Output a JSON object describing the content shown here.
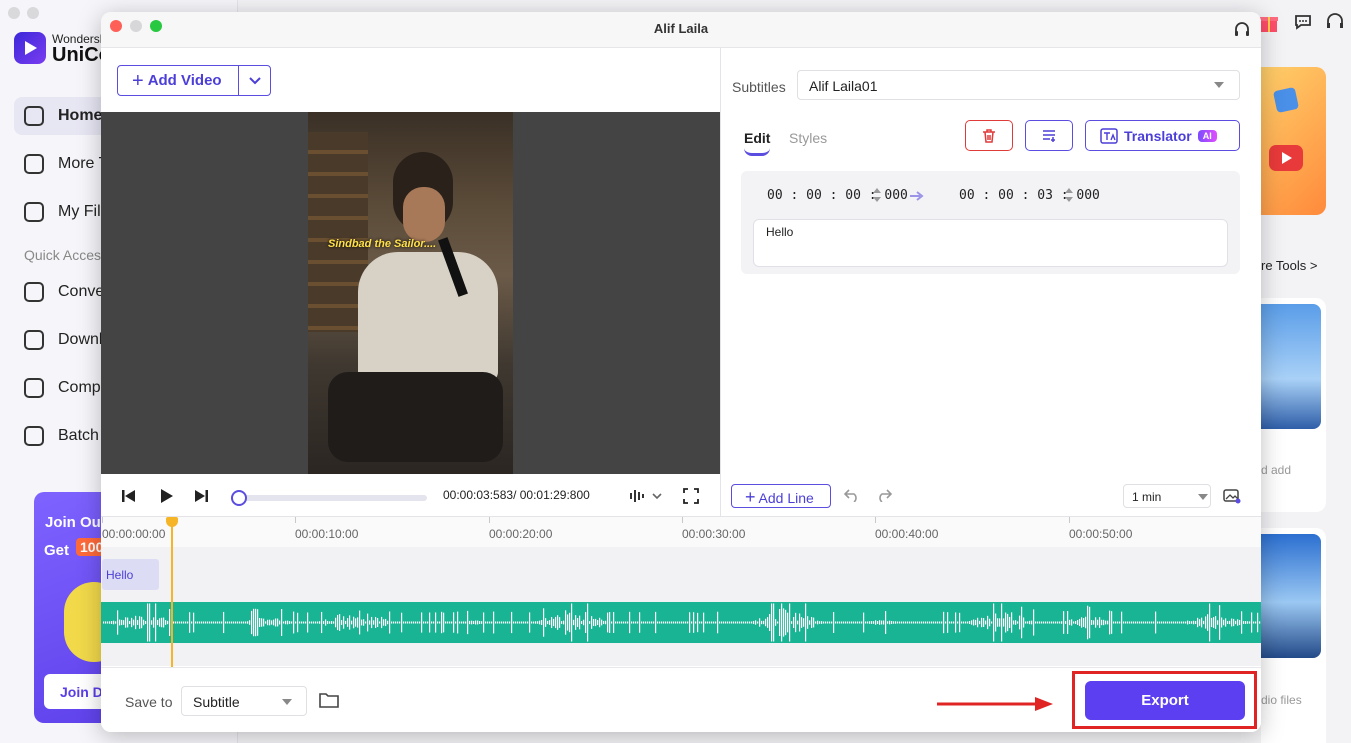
{
  "background_app": {
    "brand_line1": "Wondersh",
    "brand_line2": "UniCo",
    "nav": [
      {
        "label": "Home"
      },
      {
        "label": "More T"
      },
      {
        "label": "My Fil"
      }
    ],
    "quick_access_label": "Quick Acces",
    "quick_items": [
      {
        "label": "Conve"
      },
      {
        "label": "Downl"
      },
      {
        "label": "Comp"
      },
      {
        "label": "Batch"
      }
    ],
    "promo": {
      "line1": "Join Ou",
      "line2": "Get",
      "badge": "100",
      "button": "Join D"
    },
    "more_tools": "re Tools >",
    "card2_text": "d add",
    "card3_text": "dio files"
  },
  "window": {
    "title": "Alif Laila"
  },
  "add_video": {
    "label": "Add Video"
  },
  "video": {
    "subtitle_overlay": "Sindbad the Sailor...."
  },
  "player": {
    "time_current": "00:00:03:583",
    "time_total": "00:01:29:800",
    "time_readout": "00:00:03:583/ 00:01:29:800",
    "progress_fraction": 0.04
  },
  "subtitles": {
    "label": "Subtitles",
    "selected": "Alif Laila01",
    "tabs": [
      "Edit",
      "Styles"
    ],
    "active_tab": "Edit",
    "translator_label": "Translator",
    "ai_badge": "AI",
    "entry": {
      "start": "00 : 00 : 00 : 000",
      "end": "00 : 00 : 03 : 000",
      "text": "Hello"
    }
  },
  "toolbar": {
    "add_line": "Add Line",
    "zoom": "1 min"
  },
  "timeline": {
    "ticks": [
      "00:00:00:00",
      "00:00:10:00",
      "00:00:20:00",
      "00:00:30:00",
      "00:00:40:00",
      "00:00:50:00"
    ],
    "subtitle_chip": "Hello"
  },
  "footer": {
    "save_to_label": "Save to",
    "save_to_value": "Subtitle",
    "export_label": "Export"
  },
  "colors": {
    "accent": "#5b3ff0",
    "waveform": "#19b494",
    "playhead": "#f5b526",
    "highlight": "#e02424"
  }
}
